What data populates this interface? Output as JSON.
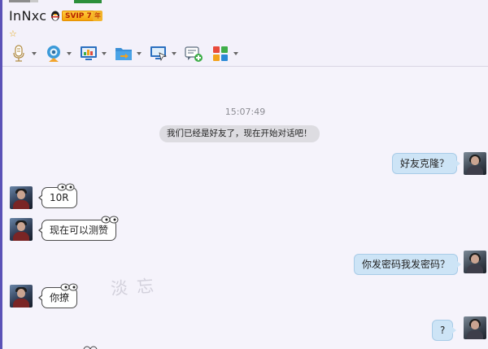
{
  "header": {
    "contact_name": "InNxc",
    "vip_label": "SVIP 7",
    "year_label": "年",
    "level_star": "☆"
  },
  "toolbar": {
    "items": [
      {
        "icon": "microphone-icon",
        "has_dropdown": true
      },
      {
        "icon": "webcam-icon",
        "has_dropdown": true
      },
      {
        "icon": "screen-share-icon",
        "has_dropdown": true
      },
      {
        "icon": "file-transfer-icon",
        "has_dropdown": true
      },
      {
        "icon": "remote-desktop-icon",
        "has_dropdown": true
      },
      {
        "icon": "new-chat-icon",
        "has_dropdown": false
      },
      {
        "icon": "apps-grid-icon",
        "has_dropdown": true
      }
    ]
  },
  "chat": {
    "timestamp": "15:07:49",
    "system_message": "我们已经是好友了，现在开始对话吧！",
    "messages": [
      {
        "side": "out",
        "text": "好友克隆？"
      },
      {
        "side": "in",
        "text": "10R"
      },
      {
        "side": "in",
        "text": "现在可以测赞"
      },
      {
        "side": "out",
        "text": "你发密码我发密码？"
      },
      {
        "side": "in",
        "text": "你撩"
      },
      {
        "side": "out",
        "text": "?"
      }
    ],
    "watermark": "淡忘"
  },
  "colors": {
    "accent_left_edge": "#5b52b7",
    "outgoing_bubble": "#cde4f6",
    "incoming_bubble": "#ffffff",
    "vip_gold": "#f5a30c"
  }
}
